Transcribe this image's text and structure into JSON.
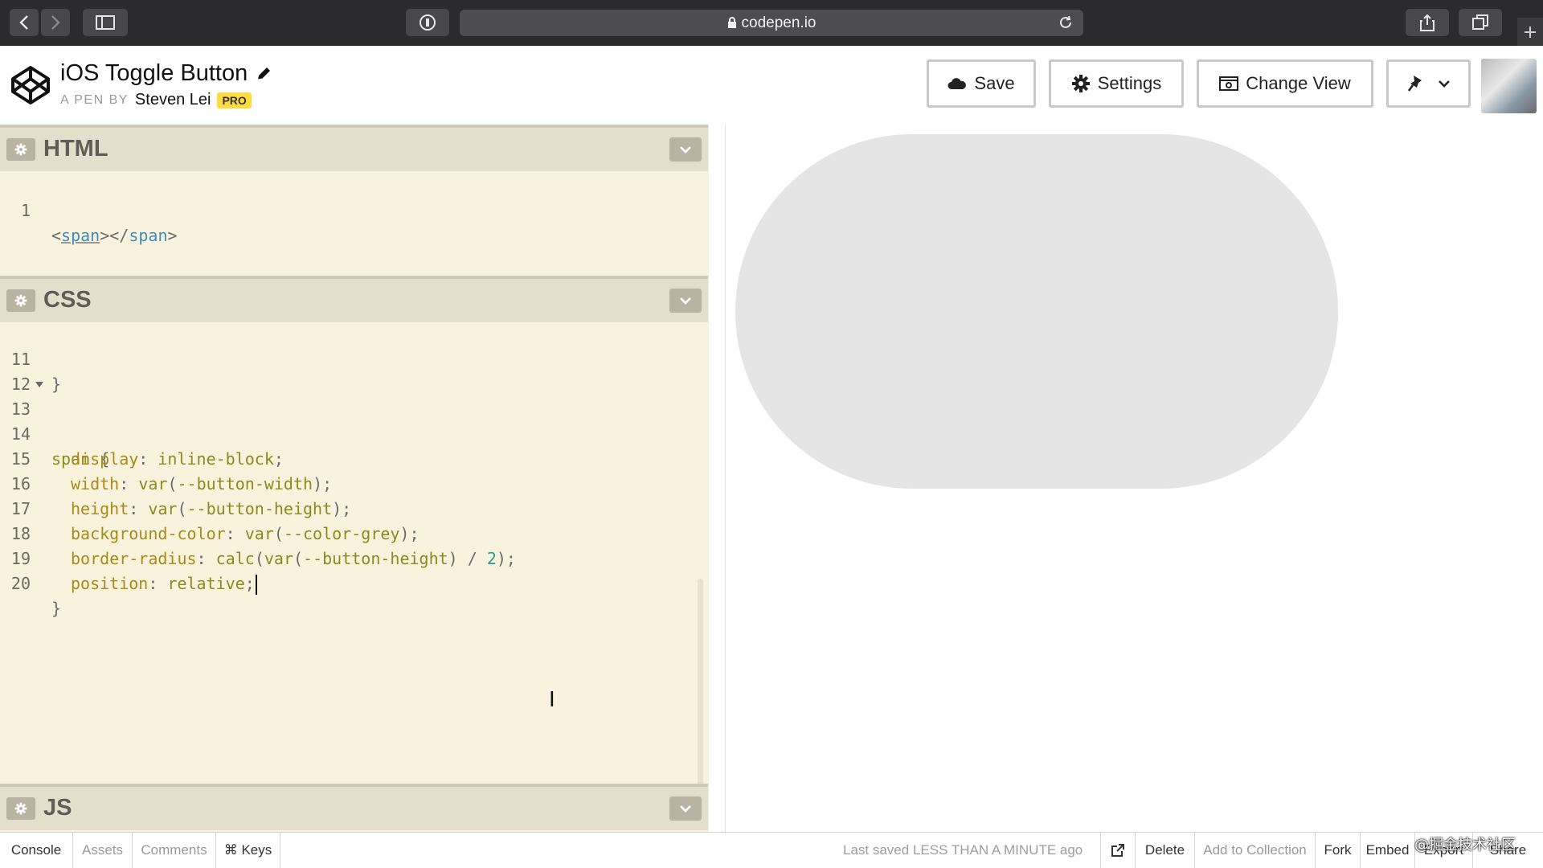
{
  "browser": {
    "url": "codepen.io"
  },
  "pen": {
    "title": "iOS Toggle Button",
    "by_label": "A PEN BY",
    "author": "Steven Lei",
    "badge": "PRO"
  },
  "header_buttons": {
    "save": "Save",
    "settings": "Settings",
    "change_view": "Change View"
  },
  "editors": {
    "html": {
      "label": "HTML",
      "line_number": "1",
      "code": {
        "open_lt": "<",
        "open_tag": "span",
        "mid": "></",
        "close_tag": "span",
        "close_gt": ">"
      }
    },
    "css": {
      "label": "CSS",
      "lines": [
        {
          "n": "11",
          "text": "}"
        },
        {
          "n": "12",
          "text": ""
        },
        {
          "n": "13",
          "selector": "span",
          "brace": " {"
        },
        {
          "n": "14",
          "prop": "display",
          "val": "inline-block"
        },
        {
          "n": "15",
          "prop": "width",
          "fn": "var",
          "arg": "--button-width"
        },
        {
          "n": "16",
          "prop": "height",
          "fn": "var",
          "arg": "--button-height"
        },
        {
          "n": "17",
          "prop": "background-color",
          "fn": "var",
          "arg": "--color-grey"
        },
        {
          "n": "18",
          "prop": "border-radius",
          "fn": "calc",
          "inner_fn": "var",
          "arg": "--button-height",
          "op": "/",
          "num": "2"
        },
        {
          "n": "19",
          "prop": "position",
          "val": "relative"
        },
        {
          "n": "20",
          "text": "}"
        }
      ]
    },
    "js": {
      "label": "JS"
    }
  },
  "footer": {
    "console": "Console",
    "assets": "Assets",
    "comments": "Comments",
    "keys": "⌘ Keys",
    "last_saved": "Last saved LESS THAN A MINUTE ago",
    "delete": "Delete",
    "add_to_collection": "Add to Collection",
    "fork": "Fork",
    "embed": "Embed",
    "export": "Export",
    "share": "Share"
  },
  "watermark": "@掘金技术社区",
  "colors": {
    "editor_bg": "#f9f3dd",
    "pane_header": "#e4dfcb",
    "toggle_grey": "#e5e5e5",
    "pro_badge": "#ffdd40"
  },
  "icons": [
    "back-icon",
    "forward-icon",
    "sidebar-icon",
    "password-icon",
    "lock-icon",
    "reload-icon",
    "share-icon",
    "tabs-icon",
    "new-tab-icon",
    "codepen-logo",
    "pencil-icon",
    "cloud-icon",
    "gear-icon",
    "change-view-icon",
    "pin-icon",
    "chevron-down-icon",
    "external-link-icon"
  ]
}
